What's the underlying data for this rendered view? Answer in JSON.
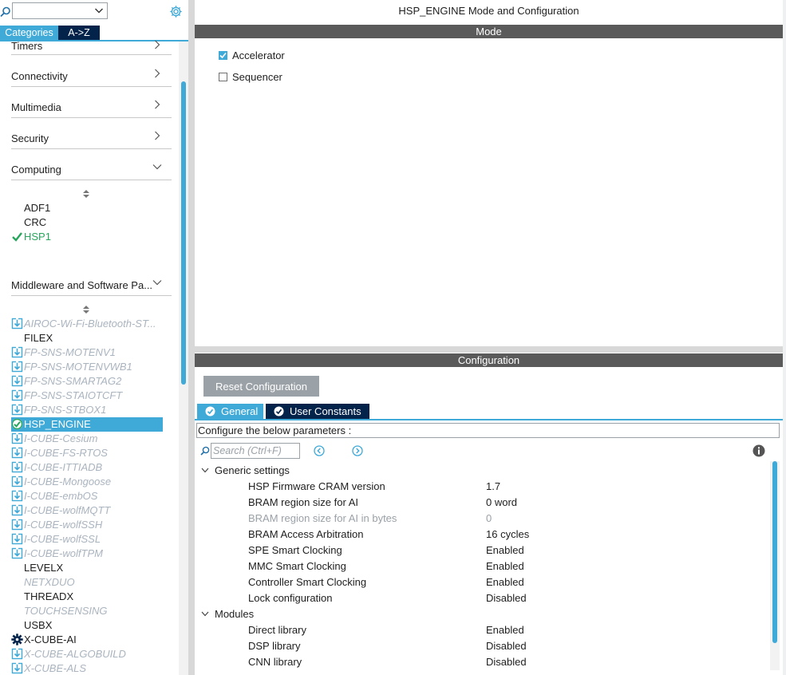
{
  "left": {
    "search_value": "",
    "tabs": [
      "Categories",
      "A->Z"
    ],
    "categories": [
      "Timers",
      "Connectivity",
      "Multimedia",
      "Security",
      "Computing",
      "Middleware and Software Pa..."
    ],
    "computing_items": [
      {
        "label": "ADF1",
        "state": "normal"
      },
      {
        "label": "CRC",
        "state": "normal"
      },
      {
        "label": "HSP1",
        "state": "ok"
      }
    ],
    "middleware_items": [
      {
        "label": "AIROC-Wi-Fi-Bluetooth-ST...",
        "state": "dim",
        "icon": "download-icon"
      },
      {
        "label": "FILEX",
        "state": "normal"
      },
      {
        "label": "FP-SNS-MOTENV1",
        "state": "dim",
        "icon": "download-icon"
      },
      {
        "label": "FP-SNS-MOTENVWB1",
        "state": "dim",
        "icon": "download-icon"
      },
      {
        "label": "FP-SNS-SMARTAG2",
        "state": "dim",
        "icon": "download-icon"
      },
      {
        "label": "FP-SNS-STAIOTCFT",
        "state": "dim",
        "icon": "download-icon"
      },
      {
        "label": "FP-SNS-STBOX1",
        "state": "dim",
        "icon": "download-icon"
      },
      {
        "label": "HSP_ENGINE",
        "state": "selected",
        "icon": "check-circle-icon"
      },
      {
        "label": "I-CUBE-Cesium",
        "state": "dim",
        "icon": "download-icon"
      },
      {
        "label": "I-CUBE-FS-RTOS",
        "state": "dim",
        "icon": "download-icon"
      },
      {
        "label": "I-CUBE-ITTIADB",
        "state": "dim",
        "icon": "download-icon"
      },
      {
        "label": "I-CUBE-Mongoose",
        "state": "dim",
        "icon": "download-icon"
      },
      {
        "label": "I-CUBE-embOS",
        "state": "dim",
        "icon": "download-icon"
      },
      {
        "label": "I-CUBE-wolfMQTT",
        "state": "dim",
        "icon": "download-icon"
      },
      {
        "label": "I-CUBE-wolfSSH",
        "state": "dim",
        "icon": "download-icon"
      },
      {
        "label": "I-CUBE-wolfSSL",
        "state": "dim",
        "icon": "download-icon"
      },
      {
        "label": "I-CUBE-wolfTPM",
        "state": "dim",
        "icon": "download-icon"
      },
      {
        "label": "LEVELX",
        "state": "normal"
      },
      {
        "label": "NETXDUO",
        "state": "dim-noicon"
      },
      {
        "label": "THREADX",
        "state": "normal"
      },
      {
        "label": "TOUCHSENSING",
        "state": "dim-noicon"
      },
      {
        "label": "USBX",
        "state": "normal"
      },
      {
        "label": "X-CUBE-AI",
        "state": "normal",
        "icon": "gear-icon"
      },
      {
        "label": "X-CUBE-ALGOBUILD",
        "state": "dim",
        "icon": "download-icon"
      },
      {
        "label": "X-CUBE-ALS",
        "state": "dim",
        "icon": "download-icon"
      }
    ]
  },
  "right": {
    "title": "HSP_ENGINE Mode and Configuration",
    "mode_bar": "Mode",
    "modes": [
      {
        "label": "Accelerator",
        "checked": true
      },
      {
        "label": "Sequencer",
        "checked": false
      }
    ],
    "config_bar": "Configuration",
    "reset_label": "Reset Configuration",
    "tabs": [
      "General",
      "User Constants"
    ],
    "hint": "Configure the below parameters :",
    "search_placeholder": "Search (Ctrl+F)",
    "groups": [
      {
        "name": "Generic settings",
        "params": [
          {
            "name": "HSP Firmware CRAM version",
            "value": "1.7",
            "grey": false
          },
          {
            "name": "BRAM region size for AI",
            "value": "0 word",
            "grey": false
          },
          {
            "name": "BRAM region size for AI in bytes",
            "value": "0",
            "grey": true
          },
          {
            "name": "BRAM Access Arbitration",
            "value": "16 cycles",
            "grey": false
          },
          {
            "name": "SPE Smart Clocking",
            "value": "Enabled",
            "grey": false
          },
          {
            "name": "MMC Smart Clocking",
            "value": "Enabled",
            "grey": false
          },
          {
            "name": "Controller Smart Clocking",
            "value": "Enabled",
            "grey": false
          },
          {
            "name": "Lock configuration",
            "value": "Disabled",
            "grey": false
          }
        ]
      },
      {
        "name": "Modules",
        "params": [
          {
            "name": "Direct library",
            "value": "Enabled",
            "grey": false
          },
          {
            "name": "DSP library",
            "value": "Disabled",
            "grey": false
          },
          {
            "name": "CNN library",
            "value": "Disabled",
            "grey": false
          }
        ]
      }
    ]
  },
  "colors": {
    "accent": "#3fa9d8",
    "navy": "#03234b",
    "ok": "#27a55c",
    "bar": "#5a5a5a"
  }
}
